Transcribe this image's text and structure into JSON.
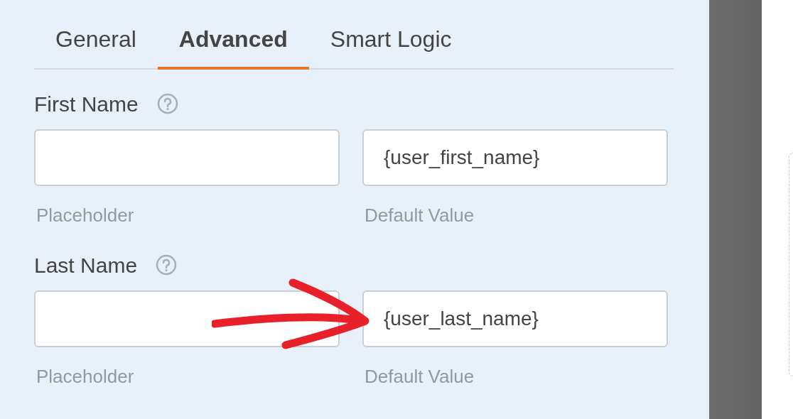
{
  "tabs": [
    {
      "label": "General",
      "selected": false
    },
    {
      "label": "Advanced",
      "selected": true
    },
    {
      "label": "Smart Logic",
      "selected": false
    }
  ],
  "fields": [
    {
      "label": "First Name",
      "inputs": [
        {
          "sublabel": "Placeholder"
        },
        {
          "value": "{user_first_name}",
          "sublabel": "Default Value"
        }
      ]
    },
    {
      "label": "Last Name",
      "inputs": [
        {
          "sublabel": "Placeholder"
        },
        {
          "value": "{user_last_name}",
          "sublabel": "Default Value"
        }
      ]
    }
  ]
}
